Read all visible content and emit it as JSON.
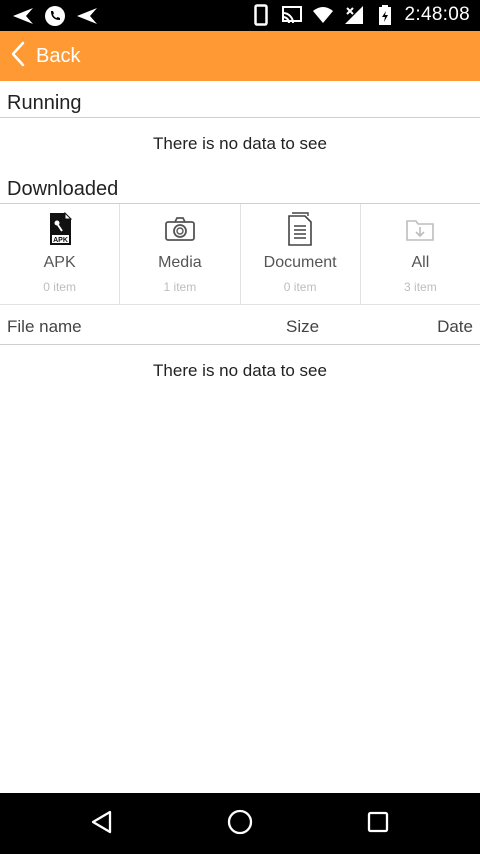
{
  "status_bar": {
    "time": "2:48:08",
    "icons": [
      "send-icon",
      "phone-icon",
      "send-icon",
      "phone-portrait-icon",
      "cast-icon",
      "wifi-icon",
      "signal-icon",
      "battery-icon"
    ]
  },
  "header": {
    "back_label": "Back",
    "color": "#ff9933"
  },
  "running": {
    "title": "Running",
    "empty_message": "There is no data to see"
  },
  "downloaded": {
    "title": "Downloaded",
    "categories": [
      {
        "label": "APK",
        "count": "0 item",
        "icon": "apk-file-icon"
      },
      {
        "label": "Media",
        "count": "1 item",
        "icon": "camera-icon"
      },
      {
        "label": "Document",
        "count": "0 item",
        "icon": "document-icon"
      },
      {
        "label": "All",
        "count": "3 item",
        "icon": "folder-download-icon"
      }
    ],
    "columns": [
      "File name",
      "Size",
      "Date"
    ],
    "empty_message": "There is no data to see"
  },
  "nav_bar": {
    "buttons": [
      "back-triangle-icon",
      "home-circle-icon",
      "recents-square-icon"
    ]
  }
}
